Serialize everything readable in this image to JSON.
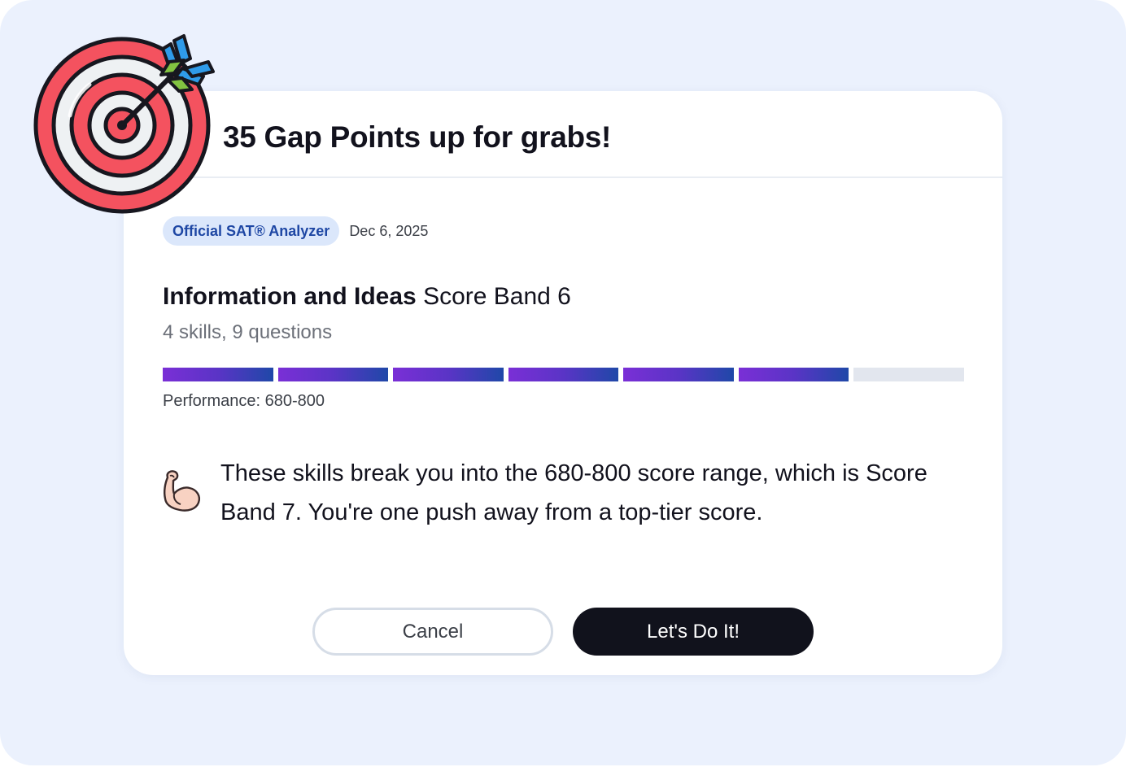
{
  "dialog": {
    "title": "35 Gap Points up for grabs!",
    "badge": "Official SAT® Analyzer",
    "date": "Dec 6, 2025",
    "skill_name": "Information and Ideas",
    "score_band": "Score Band 6",
    "skill_summary": "4 skills, 9 questions",
    "band_progress": {
      "filled": 6,
      "total": 7
    },
    "performance": "Performance: 680-800",
    "message": "These skills break you into the 680-800 score range, which is Score Band 7. You're one push away from a top-tier score.",
    "cancel_label": "Cancel",
    "confirm_label": "Let's Do It!"
  },
  "icons": {
    "header": "target-arrow-icon",
    "message": "flexed-biceps-icon"
  },
  "colors": {
    "background": "#ebf1fd",
    "band_filled_start": "#7a2fd6",
    "band_filled_end": "#1f48a8",
    "band_empty": "#e2e6ee",
    "badge_bg": "#dbe7fb",
    "badge_text": "#1e47a4",
    "primary_button": "#11121c"
  }
}
